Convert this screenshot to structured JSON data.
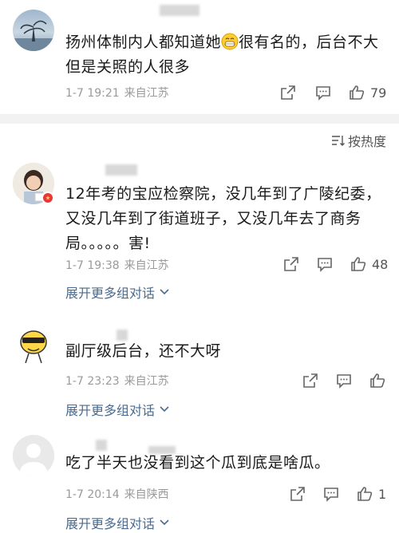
{
  "comments": [
    {
      "text_before_emoji": "扬州体制内人都知道她",
      "text_after_emoji": "很有名的，后台不大但是关照的人很多",
      "time": "1-7 19:21",
      "location": "来自江苏",
      "likes": "79",
      "emoji": "grin-emoji"
    },
    {
      "text": "12年考的宝应检察院，没几年到了广陵纪委，又没几年到了街道班子，又没几年去了商务局。。。。。害!",
      "time": "1-7 19:38",
      "location": "来自江苏",
      "likes": "48",
      "expand_label": "展开更多组对话"
    },
    {
      "text": "副厅级后台，还不大呀",
      "time": "1-7 23:23",
      "location": "来自江苏",
      "likes": "",
      "expand_label": "展开更多组对话"
    },
    {
      "text": "吃了半天也没看到这个瓜到底是啥瓜。",
      "time": "1-7 20:14",
      "location": "来自陕西",
      "likes": "1",
      "expand_label": "展开更多组对话"
    }
  ],
  "sort": {
    "label": "按热度"
  },
  "colors": {
    "link": "#4a6b8f",
    "meta": "#9a9a9a",
    "divider": "#f2f2f2"
  }
}
